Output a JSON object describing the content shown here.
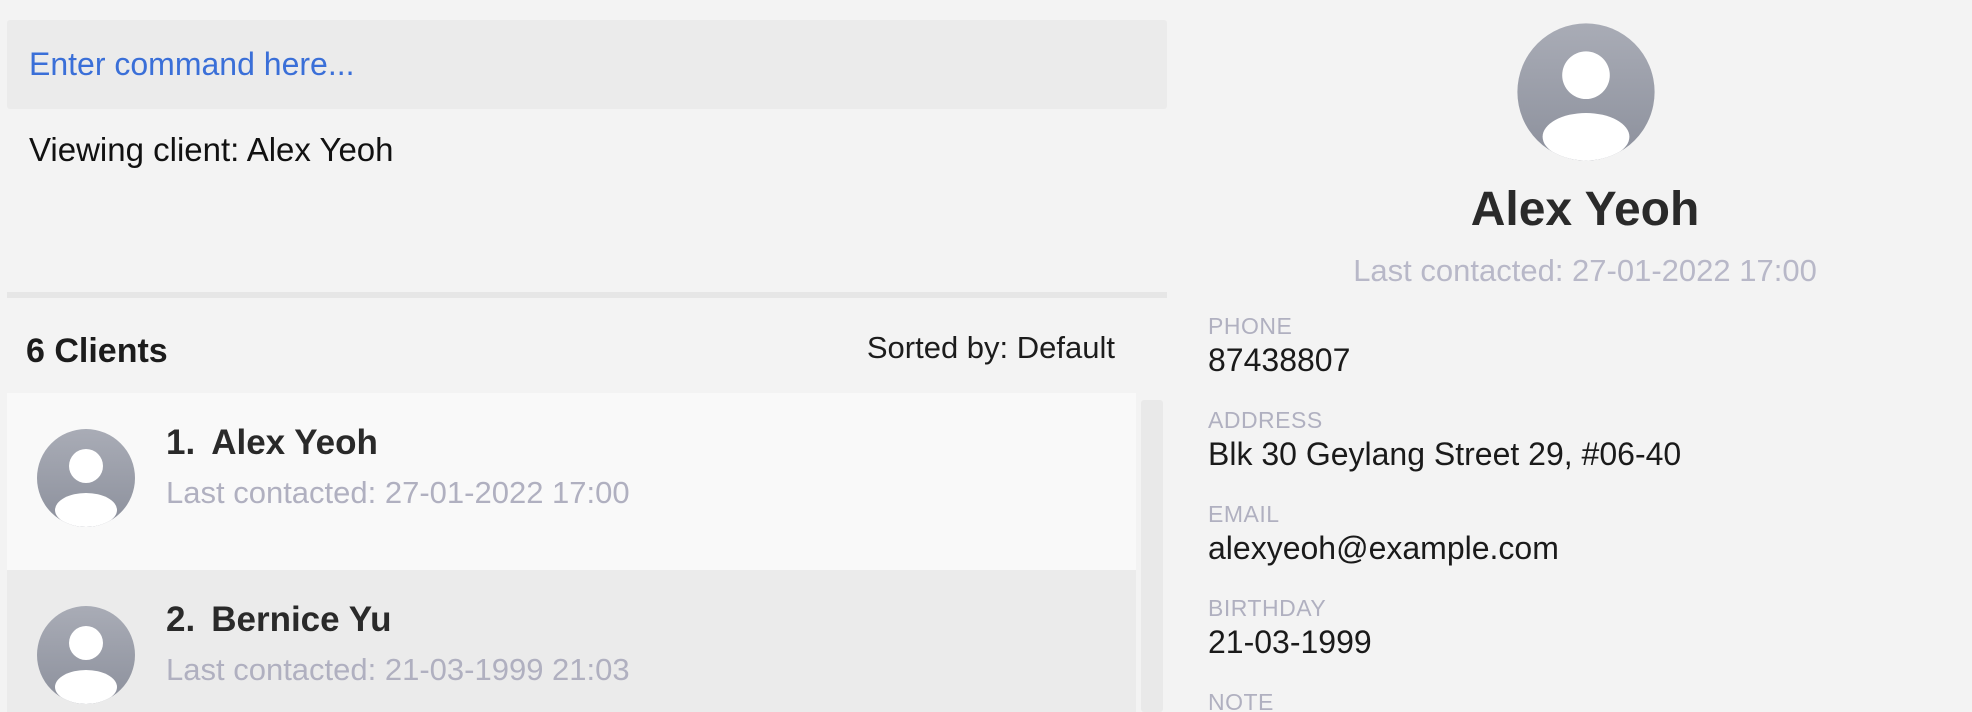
{
  "command": {
    "placeholder": "Enter command here...",
    "value": ""
  },
  "result_text": "Viewing client: Alex Yeoh",
  "list": {
    "count_label": "6 Clients",
    "sorted_label": "Sorted by: Default",
    "clients": [
      {
        "index": "1.",
        "name": "Alex Yeoh",
        "last_contacted": "Last contacted: 27-01-2022 17:00",
        "selected": true
      },
      {
        "index": "2.",
        "name": "Bernice Yu",
        "last_contacted": "Last contacted: 21-03-1999 21:03",
        "selected": false
      }
    ]
  },
  "detail": {
    "name": "Alex Yeoh",
    "last_contacted": "Last contacted: 27-01-2022 17:00",
    "fields": [
      {
        "label": "PHONE",
        "value": "87438807"
      },
      {
        "label": "ADDRESS",
        "value": "Blk 30 Geylang Street 29, #06-40"
      },
      {
        "label": "EMAIL",
        "value": "alexyeoh@example.com"
      },
      {
        "label": "BIRTHDAY",
        "value": "21-03-1999"
      },
      {
        "label": "NOTE",
        "value": ""
      }
    ]
  },
  "icons": {
    "avatar": "user-avatar-icon"
  },
  "colors": {
    "placeholder": "#3a6fd8",
    "muted_text": "#b0b0c0",
    "avatar_top": "#a9acb6",
    "avatar_bottom": "#8c909c"
  }
}
